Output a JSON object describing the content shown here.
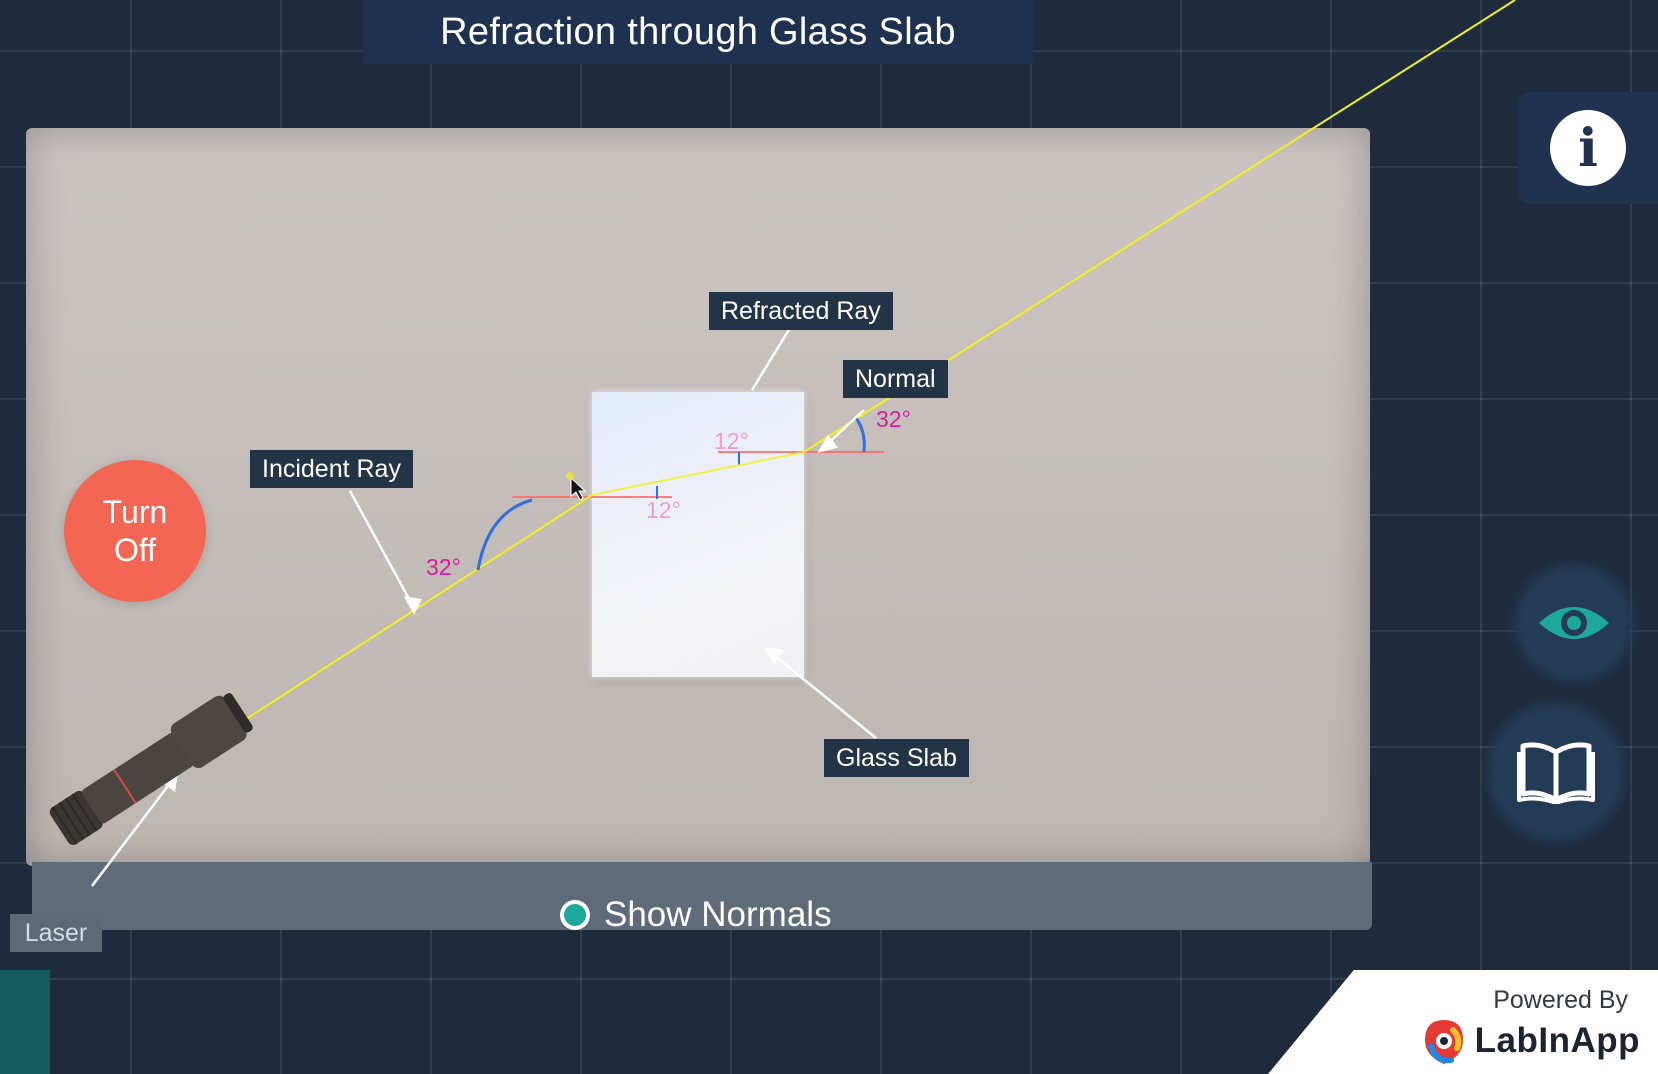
{
  "header": {
    "title": "Refraction through Glass Slab"
  },
  "scene": {
    "labels": {
      "incident_ray": "Incident Ray",
      "refracted_ray": "Refracted Ray",
      "normal": "Normal",
      "glass_slab": "Glass Slab",
      "laser": "Laser"
    },
    "angles": {
      "incidence": "32°",
      "refraction_entry": "12°",
      "refraction_exit": "12°",
      "emergence": "32°"
    },
    "laser_state": "on",
    "colors": {
      "ray": "#f2f21e",
      "normal": "#ff6b6b",
      "angle_arc": "#2f6fe0",
      "angle_text": "#d81b9c",
      "turn_off": "#f26653"
    }
  },
  "controls": {
    "turn_off_label": "Turn Off",
    "show_normals_label": "Show Normals",
    "show_normals_checked": true,
    "info_icon": "info-icon",
    "eye_icon": "eye-icon",
    "book_icon": "book-icon"
  },
  "branding": {
    "powered_by": "Powered By",
    "name": "LabInApp"
  }
}
